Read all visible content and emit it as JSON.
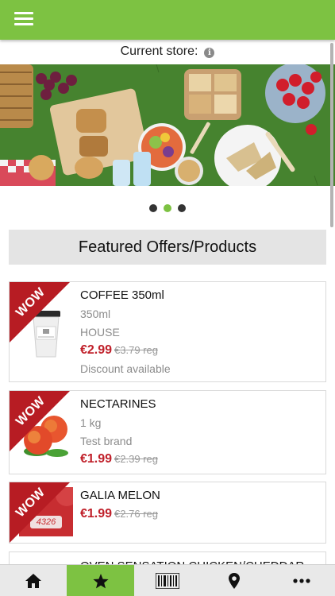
{
  "header": {
    "menu_icon": "hamburger-menu-icon",
    "background": "#7dc242"
  },
  "store": {
    "label": "Current store:",
    "info_icon": "info-icon",
    "info_glyph": "i"
  },
  "carousel": {
    "image": "picnic-food-banner",
    "slides": 3,
    "active_slide": 1
  },
  "featured": {
    "title": "Featured Offers/Products"
  },
  "badge": {
    "text": "WOW",
    "color": "#b71c23"
  },
  "products": [
    {
      "name": "COFFEE 350ml",
      "size": "350ml",
      "brand": "HOUSE",
      "price": "€2.99",
      "reg_price": "€3.79 reg",
      "note": "Discount available",
      "image": "coffee-cup-image"
    },
    {
      "name": "NECTARINES",
      "size": "1 kg",
      "brand": "Test brand",
      "price": "€1.99",
      "reg_price": "€2.39 reg",
      "image": "nectarines-image"
    },
    {
      "name": "GALIA MELON",
      "price": "€1.99",
      "reg_price": "€2.76 reg",
      "image": "melon-image",
      "sticker_text": "4326"
    },
    {
      "name": "OVEN SENSATION CHICKEN/CHEDDAR"
    }
  ],
  "tabs": [
    {
      "icon": "home-icon"
    },
    {
      "icon": "star-icon",
      "active": true
    },
    {
      "icon": "barcode-icon"
    },
    {
      "icon": "location-pin-icon"
    },
    {
      "icon": "more-icon"
    }
  ],
  "colors": {
    "accent": "#7dc242",
    "price": "#c0202a",
    "muted": "#8c8c8c"
  }
}
